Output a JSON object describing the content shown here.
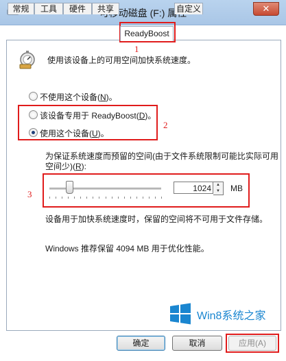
{
  "window": {
    "title": "可移动磁盘 (F:) 属性",
    "close_label": "✕"
  },
  "tabs": [
    {
      "label": "常规"
    },
    {
      "label": "工具"
    },
    {
      "label": "硬件"
    },
    {
      "label": "共享"
    },
    {
      "label": "ReadyBoost",
      "active": true
    },
    {
      "label": "自定义"
    }
  ],
  "panel": {
    "description": "使用该设备上的可用空间加快系统速度。",
    "options": [
      {
        "prefix": "不使用这个设备(",
        "key": "N",
        "suffix": ")。",
        "selected": false
      },
      {
        "prefix": "该设备专用于 ReadyBoost(",
        "key": "D",
        "suffix": ")。",
        "selected": false
      },
      {
        "prefix": "使用这个设备(",
        "key": "U",
        "suffix": ")。",
        "selected": true
      }
    ],
    "reserve_label_line1": "为保证系统速度而预留的空间(由于文件系统限制可能比实际可用",
    "reserve_label_line2_prefix": "空间少)(",
    "reserve_label_key": "R",
    "reserve_label_line2_suffix": "):",
    "reserve_value": "1024",
    "reserve_unit": "MB",
    "slider_fraction": 0.17,
    "note": "设备用于加快系统速度时，保留的空间将不可用于文件存储。",
    "recommendation": "Windows 推荐保留 4094 MB 用于优化性能。"
  },
  "annotations": {
    "n1": "1",
    "n2": "2",
    "n3": "3"
  },
  "buttons": {
    "ok": "确定",
    "cancel": "取消",
    "apply": "应用(A)"
  },
  "watermark": {
    "text": "Win8系统之家"
  },
  "colors": {
    "annotation_red": "#e01b1b",
    "titlebar": "#b9d3ee",
    "watermark_blue": "#1a86d0"
  }
}
